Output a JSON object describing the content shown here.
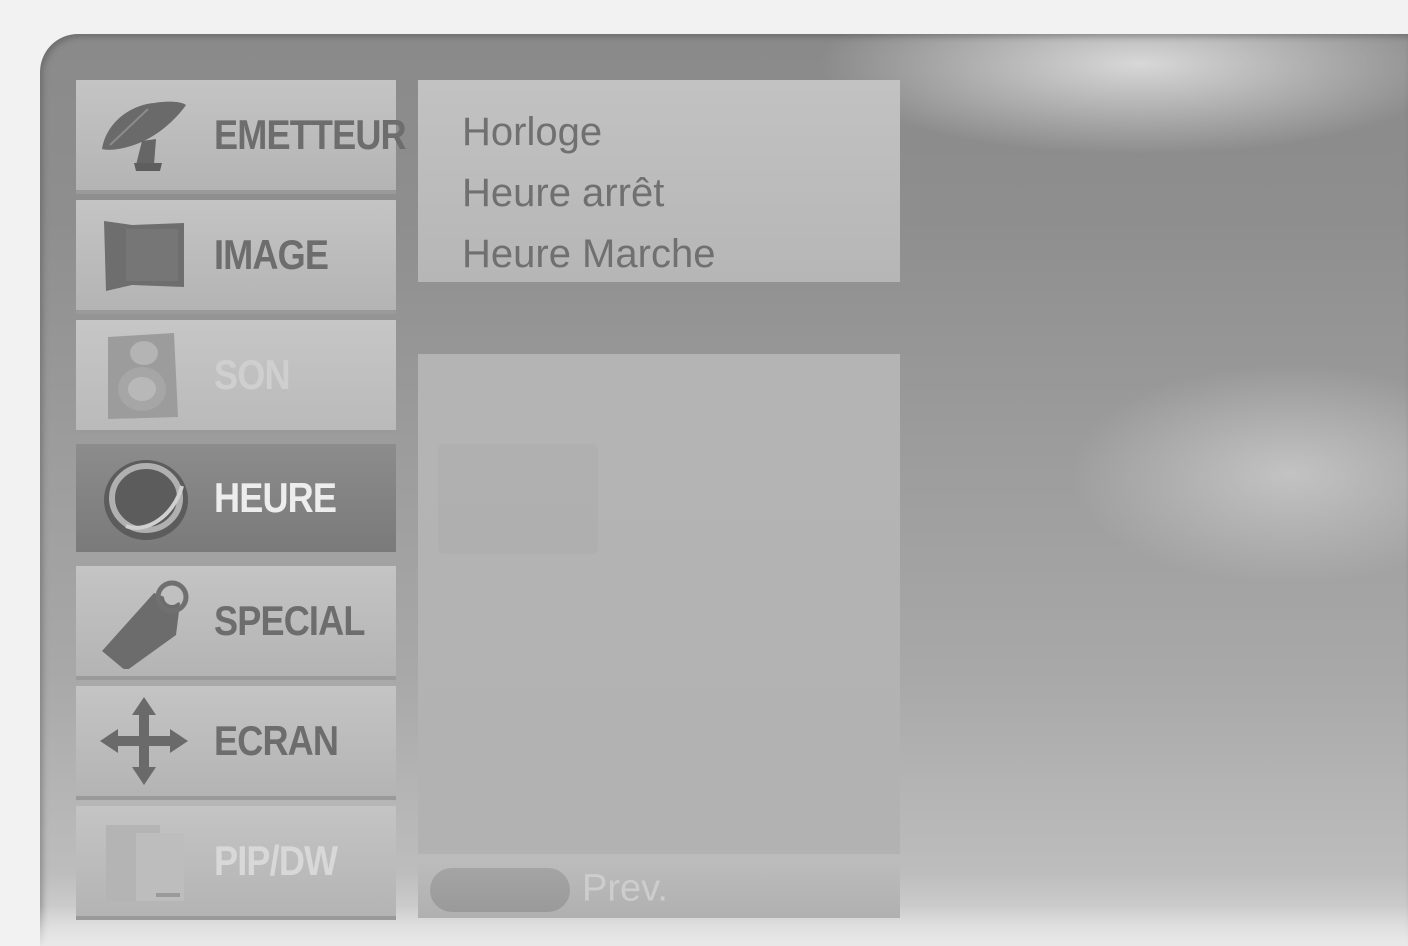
{
  "osd": {
    "main_menu": [
      {
        "label": "EMETTEUR",
        "icon": "satellite-dish-icon"
      },
      {
        "label": "IMAGE",
        "icon": "picture-icon"
      },
      {
        "label": "SON",
        "icon": "speaker-icon"
      },
      {
        "label": "HEURE",
        "icon": "clock-icon",
        "selected": true
      },
      {
        "label": "SPECIAL",
        "icon": "tag-icon"
      },
      {
        "label": "ECRAN",
        "icon": "move-arrows-icon"
      },
      {
        "label": "PIP/DW",
        "icon": "pip-icon"
      }
    ],
    "submenu": [
      "Horloge",
      "Heure arrêt",
      "Heure Marche"
    ],
    "footer": {
      "prev_label": "Prev."
    }
  }
}
